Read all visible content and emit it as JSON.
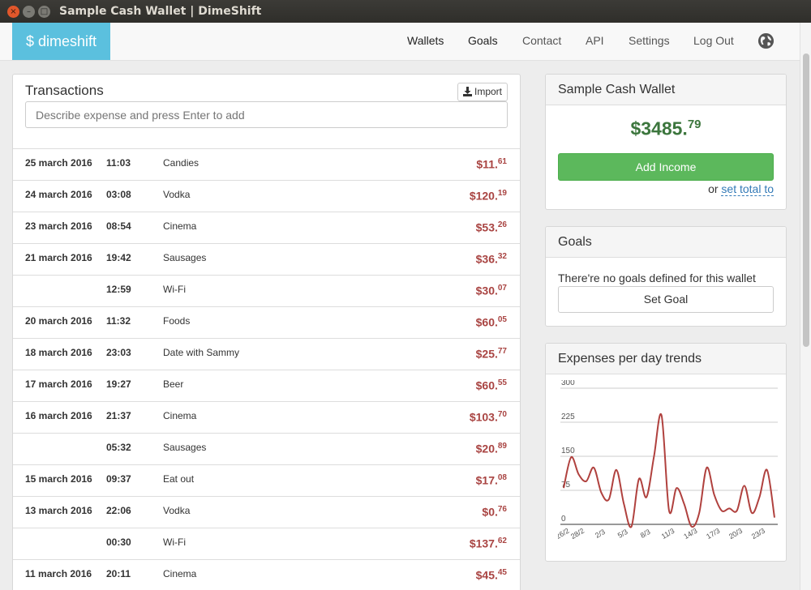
{
  "window": {
    "title": "Sample Cash Wallet | DimeShift"
  },
  "nav": {
    "brand": "$ dimeshift",
    "links": [
      "Wallets",
      "Goals",
      "Contact",
      "API",
      "Settings",
      "Log Out"
    ]
  },
  "transactions": {
    "title": "Transactions",
    "import_label": "Import",
    "input_placeholder": "Describe expense and press Enter to add",
    "rows": [
      {
        "date": "25 march 2016",
        "time": "11:03",
        "desc": "Candies",
        "amount": "$11.",
        "cents": "61"
      },
      {
        "date": "24 march 2016",
        "time": "03:08",
        "desc": "Vodka",
        "amount": "$120.",
        "cents": "19"
      },
      {
        "date": "23 march 2016",
        "time": "08:54",
        "desc": "Cinema",
        "amount": "$53.",
        "cents": "26"
      },
      {
        "date": "21 march 2016",
        "time": "19:42",
        "desc": "Sausages",
        "amount": "$36.",
        "cents": "32"
      },
      {
        "date": "",
        "time": "12:59",
        "desc": "Wi-Fi",
        "amount": "$30.",
        "cents": "07"
      },
      {
        "date": "20 march 2016",
        "time": "11:32",
        "desc": "Foods",
        "amount": "$60.",
        "cents": "05"
      },
      {
        "date": "18 march 2016",
        "time": "23:03",
        "desc": "Date with Sammy",
        "amount": "$25.",
        "cents": "77"
      },
      {
        "date": "17 march 2016",
        "time": "19:27",
        "desc": "Beer",
        "amount": "$60.",
        "cents": "55"
      },
      {
        "date": "16 march 2016",
        "time": "21:37",
        "desc": "Cinema",
        "amount": "$103.",
        "cents": "70"
      },
      {
        "date": "",
        "time": "05:32",
        "desc": "Sausages",
        "amount": "$20.",
        "cents": "89"
      },
      {
        "date": "15 march 2016",
        "time": "09:37",
        "desc": "Eat out",
        "amount": "$17.",
        "cents": "08"
      },
      {
        "date": "13 march 2016",
        "time": "22:06",
        "desc": "Vodka",
        "amount": "$0.",
        "cents": "76"
      },
      {
        "date": "",
        "time": "00:30",
        "desc": "Wi-Fi",
        "amount": "$137.",
        "cents": "62"
      },
      {
        "date": "11 march 2016",
        "time": "20:11",
        "desc": "Cinema",
        "amount": "$45.",
        "cents": "45"
      }
    ]
  },
  "wallet": {
    "title": "Sample Cash Wallet",
    "balance_main": "$3485.",
    "balance_cents": "79",
    "add_income_label": "Add Income",
    "or_label": "or",
    "set_total_label": "set total to"
  },
  "goals": {
    "title": "Goals",
    "empty_text": "There're no goals defined for this wallet",
    "set_goal_label": "Set Goal"
  },
  "trends": {
    "title": "Expenses per day trends"
  },
  "colors": {
    "brand": "#5bc0de",
    "expense": "#a94442",
    "positive": "#3c763d",
    "success_button": "#5cb85c",
    "chart_line": "#b0413e"
  },
  "chart_data": {
    "type": "line",
    "x": [
      "26/2",
      "27/2",
      "28/2",
      "29/2",
      "1/3",
      "2/3",
      "3/3",
      "4/3",
      "5/3",
      "6/3",
      "7/3",
      "8/3",
      "9/3",
      "10/3",
      "11/3",
      "12/3",
      "13/3",
      "14/3",
      "15/3",
      "16/3",
      "17/3",
      "18/3",
      "19/3",
      "20/3",
      "21/3",
      "22/3",
      "23/3",
      "24/3",
      "25/3"
    ],
    "x_ticks": [
      "26/2",
      "28/2",
      "2/3",
      "5/3",
      "8/3",
      "11/3",
      "14/3",
      "17/3",
      "20/3",
      "23/3"
    ],
    "y": [
      80,
      148,
      110,
      95,
      125,
      70,
      55,
      120,
      45,
      -5,
      100,
      60,
      150,
      240,
      30,
      80,
      45,
      -5,
      25,
      125,
      65,
      30,
      35,
      30,
      85,
      25,
      60,
      120,
      15
    ],
    "y_ticks": [
      0,
      75,
      150,
      225,
      300
    ],
    "ylim": [
      0,
      300
    ],
    "grid": true
  }
}
